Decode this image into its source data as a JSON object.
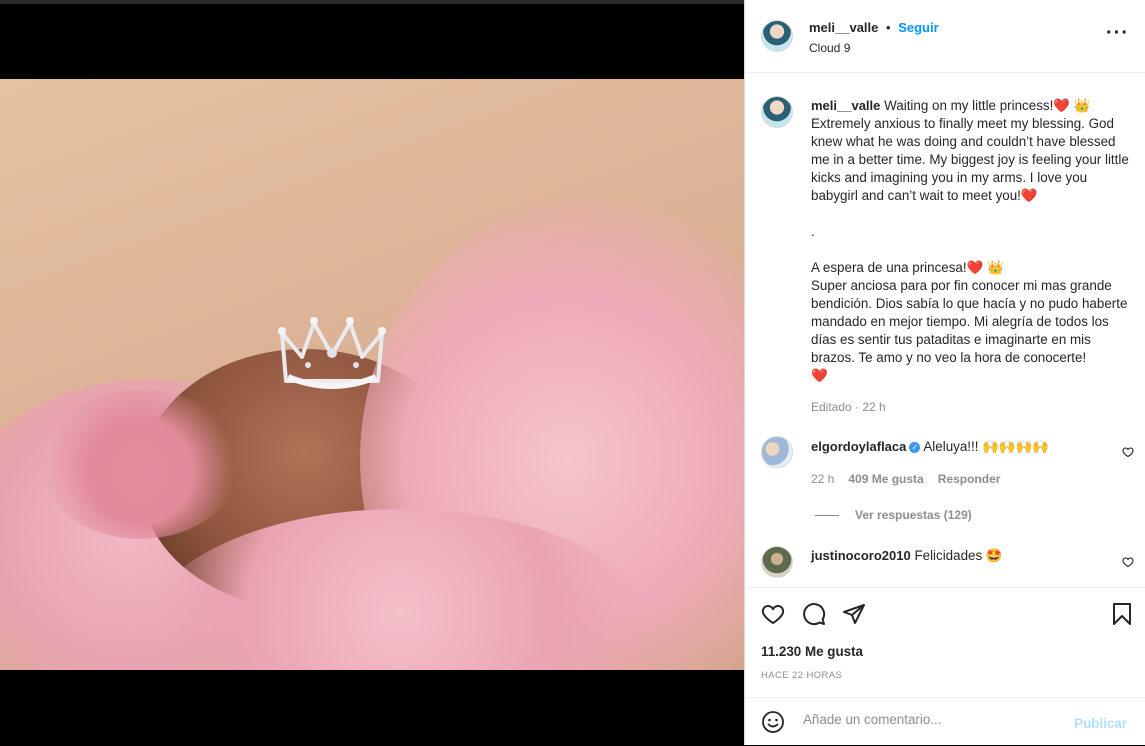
{
  "post": {
    "author": "meli__valle",
    "follow_label": "Seguir",
    "location": "Cloud 9",
    "more_label": "•••",
    "caption_en": "Waiting on my little princess!❤️ 👑\nExtremely anxious to finally meet my blessing. God knew what he was doing and couldn’t have blessed me in a better time. My biggest joy is feeling your little kicks and imagining you in my arms. I love you babygirl and can’t wait to meet you!❤️",
    "caption_sep": ".",
    "caption_es": "A espera de una princesa!❤️ 👑\nSuper anciosa para por fin conocer mi mas grande bendición. Dios sabía lo que hacía y no pudo haberte mandado en mejor tiempo. Mi alegría de todos los días es sentir tus pataditas e imaginarte en mis brazos. Te amo y no veo la hora de conocerte!\n❤️",
    "caption_meta": "Editado · 22 h"
  },
  "comments": [
    {
      "user": "elgordoylaflaca",
      "verified": true,
      "text": "Aleluya!!! 🙌🙌🙌🙌",
      "time": "22 h",
      "likes": "409 Me gusta",
      "reply_label": "Responder",
      "view_replies": "Ver respuestas (129)"
    },
    {
      "user": "justinocoro2010",
      "verified": false,
      "text": "Felicidades 🤩"
    }
  ],
  "actions": {
    "likes_count": "11.230 Me gusta",
    "time_ago": "HACE 22 HORAS"
  },
  "comment_input": {
    "placeholder": "Añade un comentario...",
    "publish_label": "Publicar"
  },
  "colors": {
    "accent": "#0095f6",
    "publish_disabled": "#b2dffc",
    "verified": "#3897f0"
  }
}
